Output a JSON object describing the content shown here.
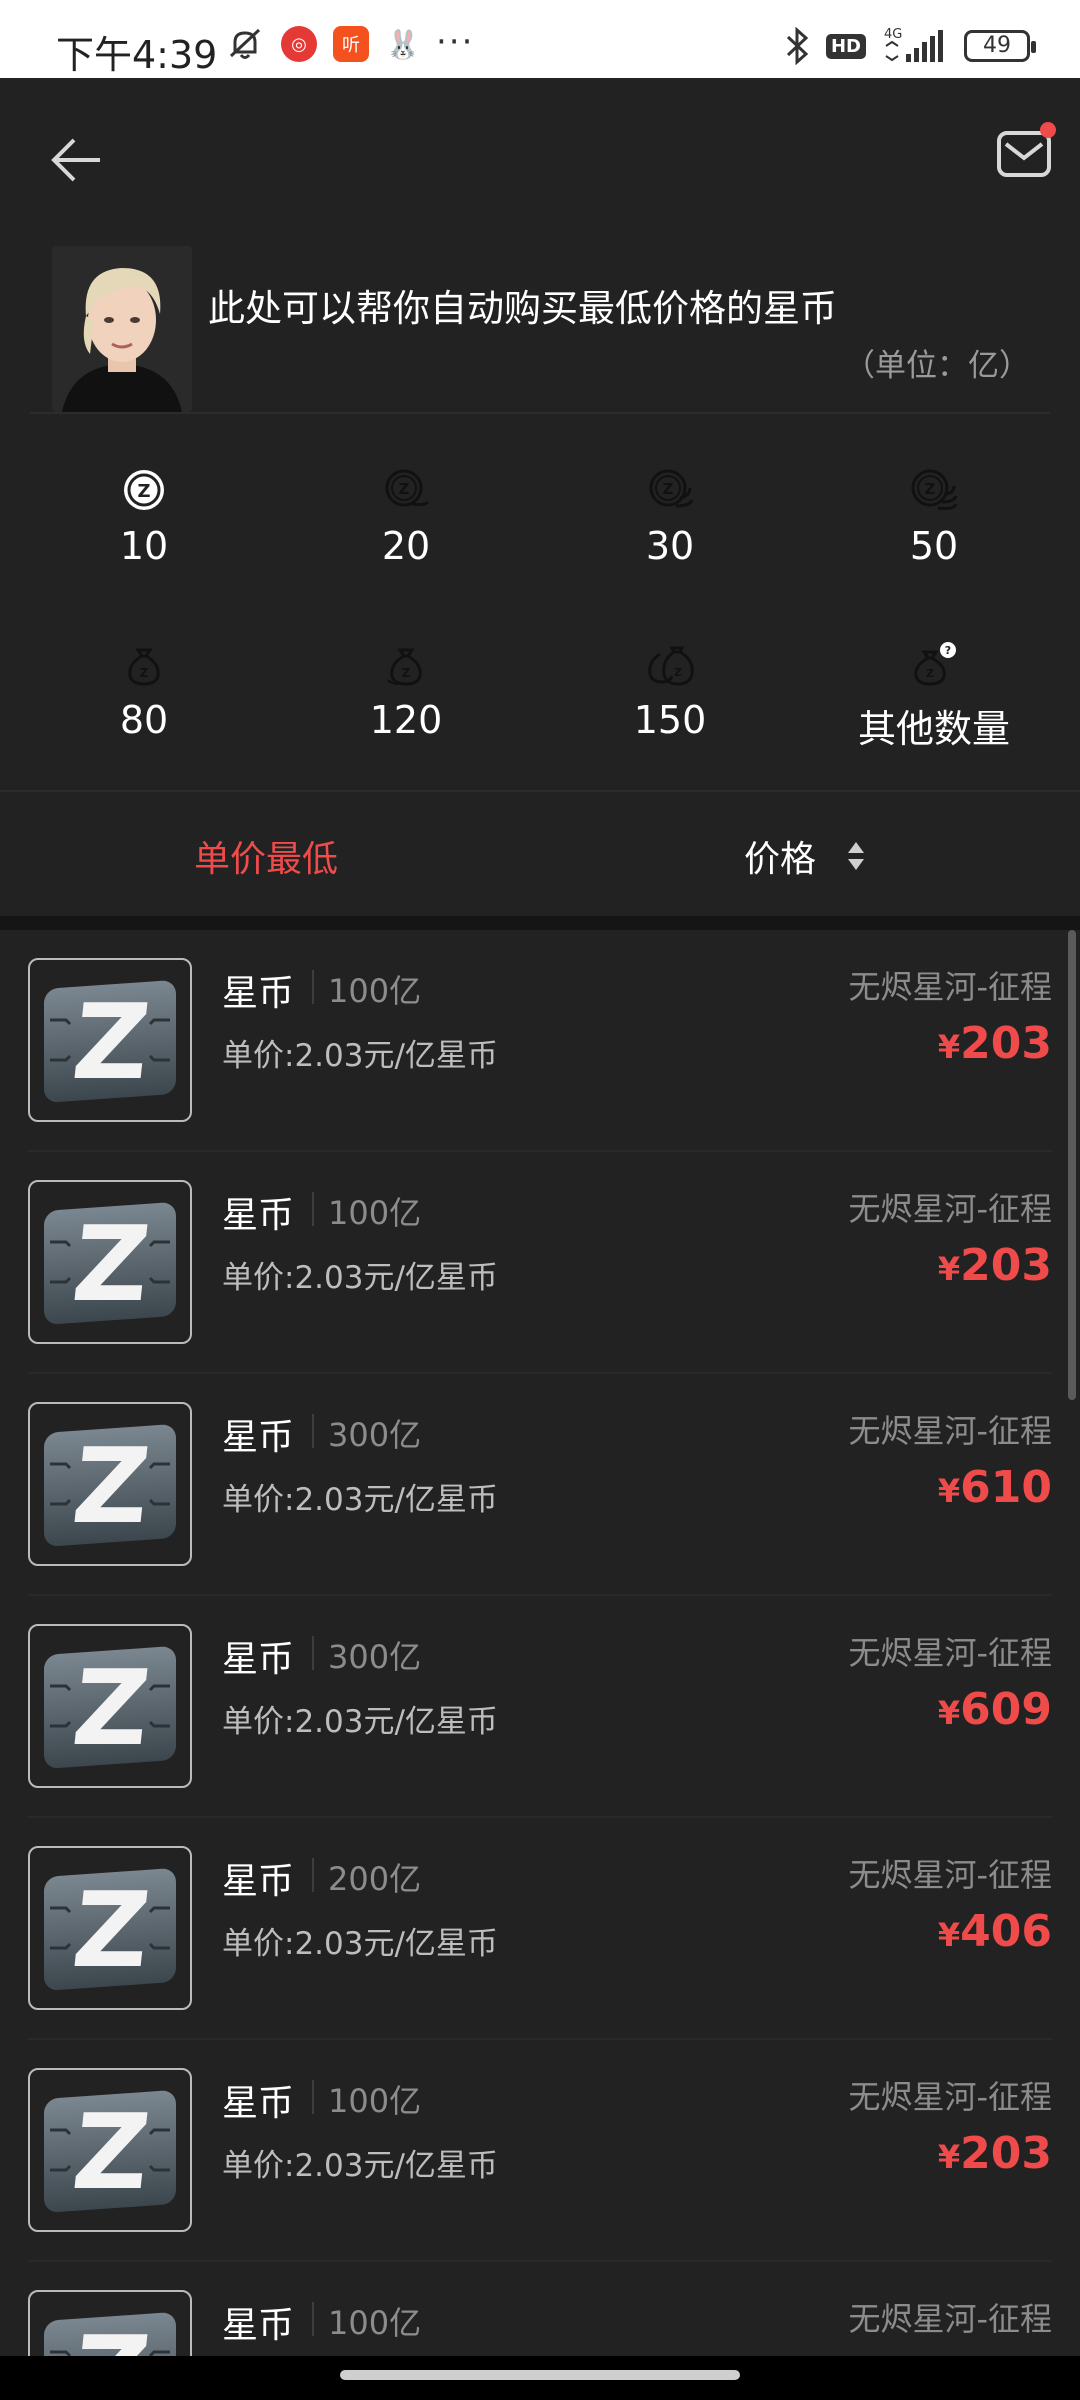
{
  "status_bar": {
    "time": "下午4:39",
    "dots": "···",
    "network": "4G",
    "hd": "HD",
    "battery": "49"
  },
  "header": {
    "back_icon": "arrow-left-icon",
    "mail_icon": "mail-icon",
    "mail_badge_color": "#ef4b4b"
  },
  "banner": {
    "message": "此处可以帮你自动购买最低价格的星币",
    "unit_note": "（单位：亿）"
  },
  "quantities": [
    {
      "label": "10",
      "icon": "coin-icon"
    },
    {
      "label": "20",
      "icon": "coins-icon"
    },
    {
      "label": "30",
      "icon": "coins-icon"
    },
    {
      "label": "50",
      "icon": "coins-icon"
    },
    {
      "label": "80",
      "icon": "money-bag-icon"
    },
    {
      "label": "120",
      "icon": "money-bag-icon"
    },
    {
      "label": "150",
      "icon": "money-bags-icon"
    },
    {
      "label": "其他数量",
      "icon": "money-bag-question-icon"
    }
  ],
  "sort": {
    "lowest_unit_price": "单价最低",
    "price": "价格"
  },
  "colors": {
    "accent": "#ef4b4b",
    "background": "#222222"
  },
  "listings": [
    {
      "name": "星币",
      "amount": "100亿",
      "unit_price": "单价:2.03元/亿星币",
      "server": "无烬星河-征程",
      "currency": "¥",
      "price": "203"
    },
    {
      "name": "星币",
      "amount": "100亿",
      "unit_price": "单价:2.03元/亿星币",
      "server": "无烬星河-征程",
      "currency": "¥",
      "price": "203"
    },
    {
      "name": "星币",
      "amount": "300亿",
      "unit_price": "单价:2.03元/亿星币",
      "server": "无烬星河-征程",
      "currency": "¥",
      "price": "610"
    },
    {
      "name": "星币",
      "amount": "300亿",
      "unit_price": "单价:2.03元/亿星币",
      "server": "无烬星河-征程",
      "currency": "¥",
      "price": "609"
    },
    {
      "name": "星币",
      "amount": "200亿",
      "unit_price": "单价:2.03元/亿星币",
      "server": "无烬星河-征程",
      "currency": "¥",
      "price": "406"
    },
    {
      "name": "星币",
      "amount": "100亿",
      "unit_price": "单价:2.03元/亿星币",
      "server": "无烬星河-征程",
      "currency": "¥",
      "price": "203"
    },
    {
      "name": "星币",
      "amount": "100亿",
      "unit_price": "",
      "server": "无烬星河-征程",
      "currency": "",
      "price": ""
    }
  ]
}
